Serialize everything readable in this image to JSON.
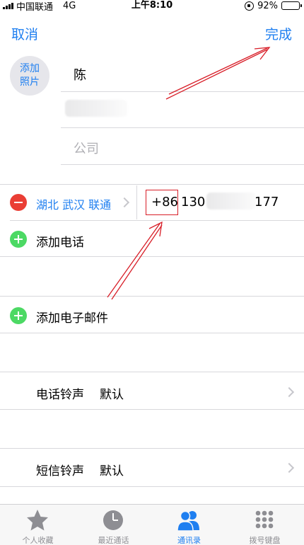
{
  "status_bar": {
    "carrier": "中国联通",
    "network": "4G",
    "time": "上午8:10",
    "battery_percent": "92%",
    "battery_level": 0.92
  },
  "nav": {
    "cancel_label": "取消",
    "done_label": "完成"
  },
  "photo": {
    "label_line1": "添加",
    "label_line2": "照片"
  },
  "name_fields": {
    "last_name_value": "陈",
    "company_placeholder": "公司"
  },
  "phone": {
    "label": "湖北 武汉 联通",
    "country_code": "+86",
    "number_prefix": "130",
    "number_suffix": "177"
  },
  "actions": {
    "add_phone": "添加电话",
    "add_email": "添加电子邮件"
  },
  "ringtone": {
    "label": "电话铃声",
    "value": "默认"
  },
  "text_tone": {
    "label": "短信铃声",
    "value": "默认"
  },
  "tabbar": {
    "tabs": [
      {
        "label": "个人收藏",
        "icon": "star-icon"
      },
      {
        "label": "最近通话",
        "icon": "clock-icon"
      },
      {
        "label": "通讯录",
        "icon": "contacts-icon"
      },
      {
        "label": "拨号键盘",
        "icon": "keypad-icon"
      }
    ]
  },
  "colors": {
    "accent": "#1f7ff0",
    "delete_red": "#ea3e35",
    "add_green": "#4cd964",
    "annotation_red": "#d81e28"
  }
}
